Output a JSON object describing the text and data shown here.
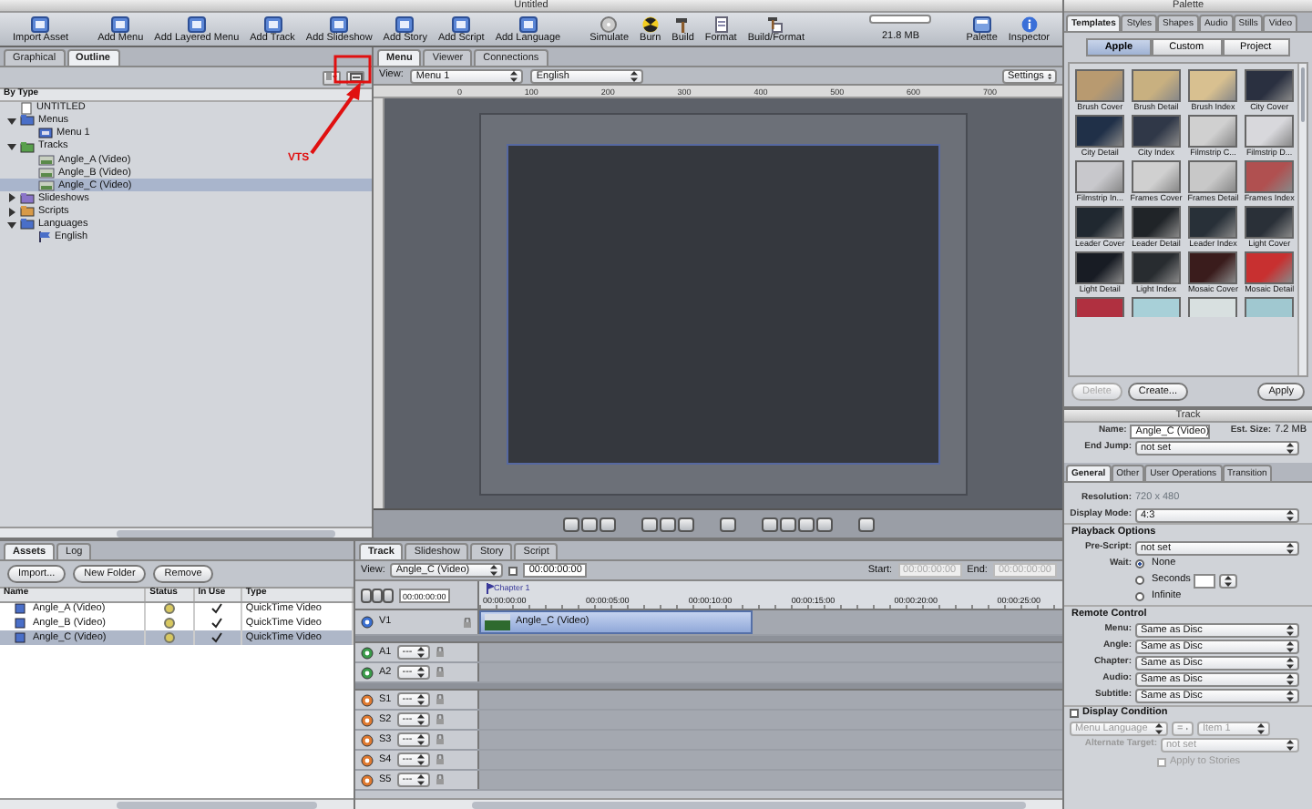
{
  "window": {
    "title": "Untitled"
  },
  "toolbar": {
    "groups": [
      [
        {
          "label": "Import Asset"
        }
      ],
      [
        {
          "label": "Add Menu"
        },
        {
          "label": "Add Layered Menu"
        },
        {
          "label": "Add Track"
        },
        {
          "label": "Add Slideshow"
        },
        {
          "label": "Add Story"
        },
        {
          "label": "Add Script"
        },
        {
          "label": "Add Language"
        }
      ],
      [
        {
          "label": "Simulate"
        },
        {
          "label": "Burn"
        },
        {
          "label": "Build"
        },
        {
          "label": "Format"
        },
        {
          "label": "Build/Format"
        }
      ]
    ],
    "disk_usage": "21.8 MB",
    "right_buttons": [
      {
        "label": "Palette"
      },
      {
        "label": "Inspector"
      }
    ]
  },
  "outline": {
    "tabs": [
      {
        "label": "Graphical",
        "selected": false
      },
      {
        "label": "Outline",
        "selected": true
      }
    ],
    "header": "By Type",
    "tree": [
      {
        "label": "UNTITLED",
        "kind": "project",
        "selected": false
      },
      {
        "label": "Menus",
        "kind": "folder",
        "color": "#4a6fc8",
        "expanded": true,
        "selected": false,
        "children": [
          {
            "label": "Menu 1",
            "kind": "menu",
            "selected": false
          }
        ]
      },
      {
        "label": "Tracks",
        "kind": "folder",
        "color": "#58a04c",
        "expanded": true,
        "selected": false,
        "children": [
          {
            "label": "Angle_A (Video)",
            "kind": "track",
            "selected": false
          },
          {
            "label": "Angle_B (Video)",
            "kind": "track",
            "selected": false
          },
          {
            "label": "Angle_C (Video)",
            "kind": "track",
            "selected": true
          }
        ]
      },
      {
        "label": "Slideshows",
        "kind": "folder",
        "color": "#8a74c8",
        "expanded": false,
        "selected": false
      },
      {
        "label": "Scripts",
        "kind": "folder",
        "color": "#d89a48",
        "expanded": false,
        "selected": false
      },
      {
        "label": "Languages",
        "kind": "folder",
        "color": "#4a6fc8",
        "expanded": true,
        "selected": false,
        "children": [
          {
            "label": "English",
            "kind": "language",
            "selected": false
          }
        ]
      }
    ]
  },
  "annotation": {
    "label": "VTS"
  },
  "editor": {
    "tabs": [
      {
        "label": "Menu",
        "selected": true
      },
      {
        "label": "Viewer",
        "selected": false
      },
      {
        "label": "Connections",
        "selected": false
      }
    ],
    "view_label": "View:",
    "menu_select": "Menu 1",
    "language_select": "English",
    "settings": "Settings",
    "ruler": [
      "0",
      "100",
      "200",
      "300",
      "400",
      "500",
      "600",
      "700"
    ]
  },
  "palette": {
    "title": "Palette",
    "tabs": [
      {
        "label": "Templates",
        "selected": true
      },
      {
        "label": "Styles",
        "selected": false
      },
      {
        "label": "Shapes",
        "selected": false
      },
      {
        "label": "Audio",
        "selected": false
      },
      {
        "label": "Stills",
        "selected": false
      },
      {
        "label": "Video",
        "selected": false
      }
    ],
    "scope": [
      {
        "label": "Apple",
        "selected": true
      },
      {
        "label": "Custom",
        "selected": false
      },
      {
        "label": "Project",
        "selected": false
      }
    ],
    "templates": [
      "Brush Cover",
      "Brush Detail",
      "Brush Index",
      "City Cover",
      "City Detail",
      "City Index",
      "Filmstrip C...",
      "Filmstrip D...",
      "Filmstrip In...",
      "Frames Cover",
      "Frames Detail",
      "Frames Index",
      "Leader Cover",
      "Leader Detail",
      "Leader Index",
      "Light Cover",
      "Light Detail",
      "Light Index",
      "Mosaic Cover",
      "Mosaic Detail"
    ],
    "buttons": [
      {
        "label": "Delete",
        "disabled": true
      },
      {
        "label": "Create...",
        "disabled": false
      },
      {
        "label": "Apply",
        "disabled": false
      }
    ]
  },
  "inspector": {
    "title": "Track",
    "name_label": "Name:",
    "name": "Angle_C (Video)",
    "size_label": "Est. Size:",
    "size": "7.2 MB",
    "end_jump_label": "End Jump:",
    "end_jump": "not set",
    "tabs": [
      {
        "label": "General",
        "selected": true
      },
      {
        "label": "Other",
        "selected": false
      },
      {
        "label": "User Operations",
        "selected": false
      },
      {
        "label": "Transition",
        "selected": false
      }
    ],
    "resolution_label": "Resolution:",
    "resolution": "720 x 480",
    "display_mode_label": "Display Mode:",
    "display_mode": "4:3",
    "playback_header": "Playback Options",
    "pre_script_label": "Pre-Script:",
    "pre_script": "not set",
    "wait_label": "Wait:",
    "wait_options": [
      {
        "label": "None",
        "selected": true
      },
      {
        "label": "Seconds",
        "selected": false
      },
      {
        "label": "Infinite",
        "selected": false
      }
    ],
    "remote_header": "Remote Control",
    "remote": [
      {
        "label": "Menu:",
        "value": "Same as Disc"
      },
      {
        "label": "Angle:",
        "value": "Same as Disc"
      },
      {
        "label": "Chapter:",
        "value": "Same as Disc"
      },
      {
        "label": "Audio:",
        "value": "Same as Disc"
      },
      {
        "label": "Subtitle:",
        "value": "Same as Disc"
      }
    ],
    "display_condition": {
      "label": "Display Condition",
      "checked": false
    },
    "condition_fields": [
      "Menu Language",
      "=",
      "Item 1"
    ],
    "alt_target_label": "Alternate Target:",
    "alt_target": "not set",
    "apply_to_stories": {
      "label": "Apply to Stories",
      "checked": false,
      "disabled": true
    }
  },
  "assets": {
    "tabs": [
      {
        "label": "Assets",
        "selected": true
      },
      {
        "label": "Log",
        "selected": false
      }
    ],
    "buttons": [
      "Import...",
      "New Folder",
      "Remove"
    ],
    "columns": [
      "Name",
      "Status",
      "In Use",
      "Type"
    ],
    "rows": [
      {
        "name": "Angle_A (Video)",
        "in_use": true,
        "type": "QuickTime Video",
        "selected": false
      },
      {
        "name": "Angle_B (Video)",
        "in_use": true,
        "type": "QuickTime Video",
        "selected": false
      },
      {
        "name": "Angle_C (Video)",
        "in_use": true,
        "type": "QuickTime Video",
        "selected": true
      }
    ]
  },
  "timeline": {
    "tabs": [
      {
        "label": "Track",
        "selected": true
      },
      {
        "label": "Slideshow",
        "selected": false
      },
      {
        "label": "Story",
        "selected": false
      },
      {
        "label": "Script",
        "selected": false
      }
    ],
    "view_label": "View:",
    "view": "Angle_C (Video)",
    "view_checkbox": {
      "checked": false
    },
    "timecode": "00:00:00:00",
    "start_label": "Start:",
    "start": "00:00:00:00",
    "end_label": "End:",
    "end": "00:00:00:00",
    "header_timecode": "00:00:00:00",
    "marker": "Chapter 1",
    "ruler": [
      "00:00:00:00",
      "00:00:05:00",
      "00:00:10:00",
      "00:00:15:00",
      "00:00:20:00",
      "00:00:25:00"
    ],
    "tracks": [
      {
        "label": "V1",
        "kind": "video",
        "clip": "Angle_C (Video)"
      },
      {
        "label": "A1",
        "kind": "audio",
        "stream": "---"
      },
      {
        "label": "A2",
        "kind": "audio",
        "stream": "---"
      },
      {
        "label": "S1",
        "kind": "subtitle",
        "stream": "---"
      },
      {
        "label": "S2",
        "kind": "subtitle",
        "stream": "---"
      },
      {
        "label": "S3",
        "kind": "subtitle",
        "stream": "---"
      },
      {
        "label": "S4",
        "kind": "subtitle",
        "stream": "---"
      },
      {
        "label": "S5",
        "kind": "subtitle",
        "stream": "---"
      }
    ]
  }
}
